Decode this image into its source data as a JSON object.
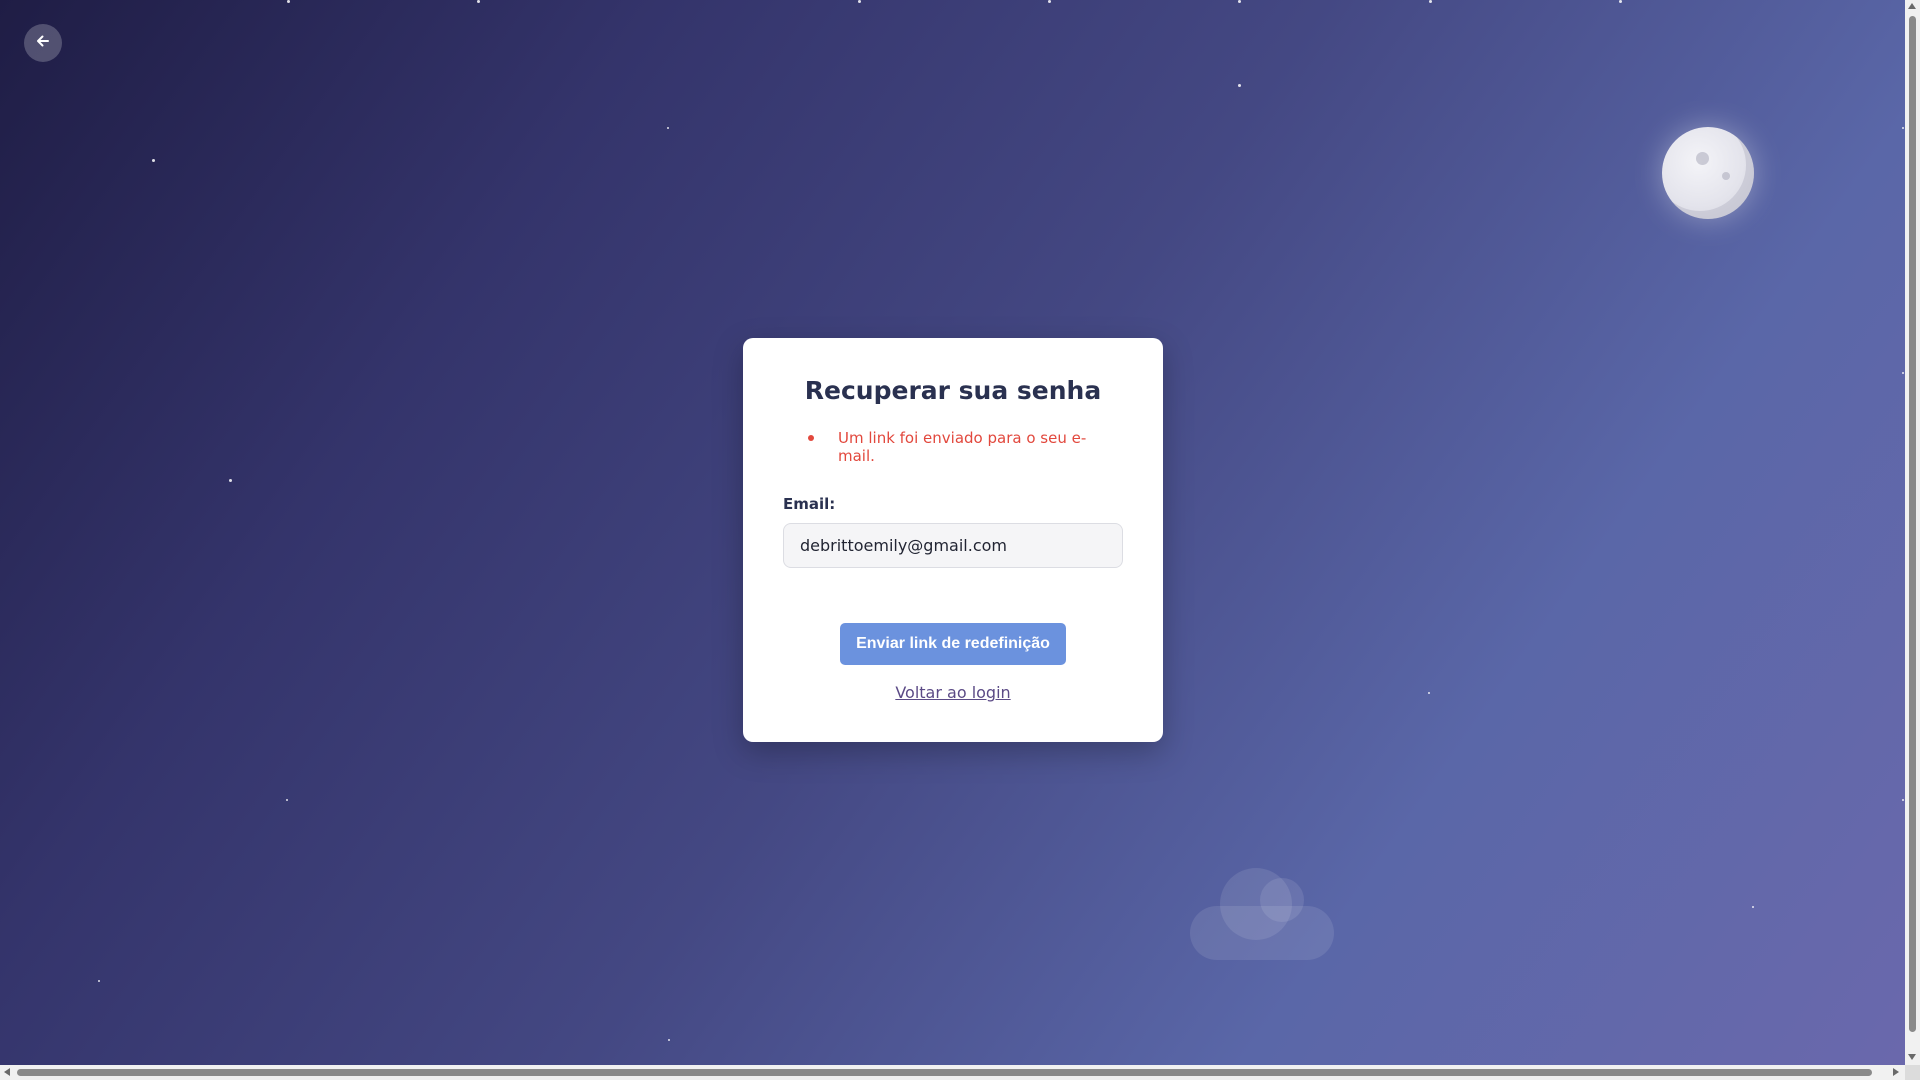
{
  "page": {
    "back_icon": "arrow-left-icon"
  },
  "decor": {
    "moon_icon": "moon",
    "cloud_icon": "cloud"
  },
  "card": {
    "title": "Recuperar sua senha",
    "messages": [
      "Um link foi enviado para o seu e-mail."
    ],
    "email_label": "Email:",
    "email_value": "debrittoemily@gmail.com",
    "submit_label": "Enviar link de redefinição",
    "back_to_login_label": "Voltar ao login"
  },
  "colors": {
    "message": "#e2483d",
    "button": "#6b92de",
    "link": "#5b4a86",
    "title": "#2a3150"
  }
}
